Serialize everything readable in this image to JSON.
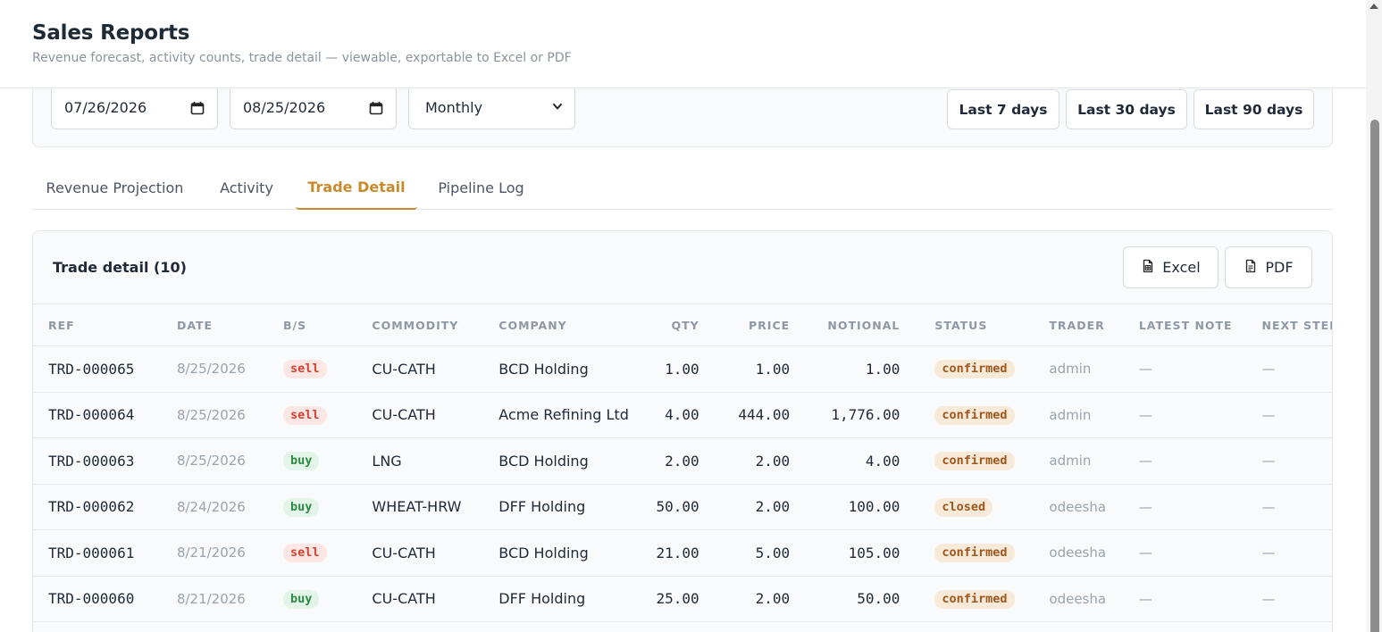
{
  "header": {
    "title": "Sales Reports",
    "subtitle": "Revenue forecast, activity counts, trade detail — viewable, exportable to Excel or PDF"
  },
  "filters": {
    "start_date": "07/26/2026",
    "end_date": "08/25/2026",
    "granularity": "Monthly",
    "quick_ranges": [
      "Last 7 days",
      "Last 30 days",
      "Last 90 days"
    ]
  },
  "tabs": [
    {
      "label": "Revenue Projection",
      "active": false
    },
    {
      "label": "Activity",
      "active": false
    },
    {
      "label": "Trade Detail",
      "active": true
    },
    {
      "label": "Pipeline Log",
      "active": false
    }
  ],
  "trade_detail": {
    "title": "Trade detail (10)",
    "export_excel": "Excel",
    "export_pdf": "PDF",
    "columns": [
      "REF",
      "DATE",
      "B/S",
      "COMMODITY",
      "COMPANY",
      "QTY",
      "PRICE",
      "NOTIONAL",
      "STATUS",
      "TRADER",
      "LATEST NOTE",
      "NEXT STEP"
    ],
    "rows": [
      {
        "ref": "TRD-000065",
        "date": "8/25/2026",
        "side": "sell",
        "commodity": "CU-CATH",
        "company": "BCD Holding",
        "qty": "1.00",
        "price": "1.00",
        "notional": "1.00",
        "status": "confirmed",
        "trader": "admin",
        "note": "—",
        "next": "—"
      },
      {
        "ref": "TRD-000064",
        "date": "8/25/2026",
        "side": "sell",
        "commodity": "CU-CATH",
        "company": "Acme Refining Ltd",
        "qty": "4.00",
        "price": "444.00",
        "notional": "1,776.00",
        "status": "confirmed",
        "trader": "admin",
        "note": "—",
        "next": "—"
      },
      {
        "ref": "TRD-000063",
        "date": "8/25/2026",
        "side": "buy",
        "commodity": "LNG",
        "company": "BCD Holding",
        "qty": "2.00",
        "price": "2.00",
        "notional": "4.00",
        "status": "confirmed",
        "trader": "admin",
        "note": "—",
        "next": "—"
      },
      {
        "ref": "TRD-000062",
        "date": "8/24/2026",
        "side": "buy",
        "commodity": "WHEAT-HRW",
        "company": "DFF Holding",
        "qty": "50.00",
        "price": "2.00",
        "notional": "100.00",
        "status": "closed",
        "trader": "odeesha",
        "note": "—",
        "next": "—"
      },
      {
        "ref": "TRD-000061",
        "date": "8/21/2026",
        "side": "sell",
        "commodity": "CU-CATH",
        "company": "BCD Holding",
        "qty": "21.00",
        "price": "5.00",
        "notional": "105.00",
        "status": "confirmed",
        "trader": "odeesha",
        "note": "—",
        "next": "—"
      },
      {
        "ref": "TRD-000060",
        "date": "8/21/2026",
        "side": "buy",
        "commodity": "CU-CATH",
        "company": "DFF Holding",
        "qty": "25.00",
        "price": "2.00",
        "notional": "50.00",
        "status": "confirmed",
        "trader": "odeesha",
        "note": "—",
        "next": "—"
      }
    ]
  },
  "icons": {
    "calendar": "calendar-icon",
    "chevron": "chevron-down-icon",
    "excel": "spreadsheet-file-icon",
    "pdf": "document-file-icon"
  },
  "colors": {
    "accent": "#c98a2c",
    "sell_bg": "#fde7e4",
    "sell_fg": "#d6412f",
    "buy_bg": "#e3f5e8",
    "buy_fg": "#2e8a45",
    "status_bg": "#f7ead8",
    "status_fg": "#a0561c"
  }
}
